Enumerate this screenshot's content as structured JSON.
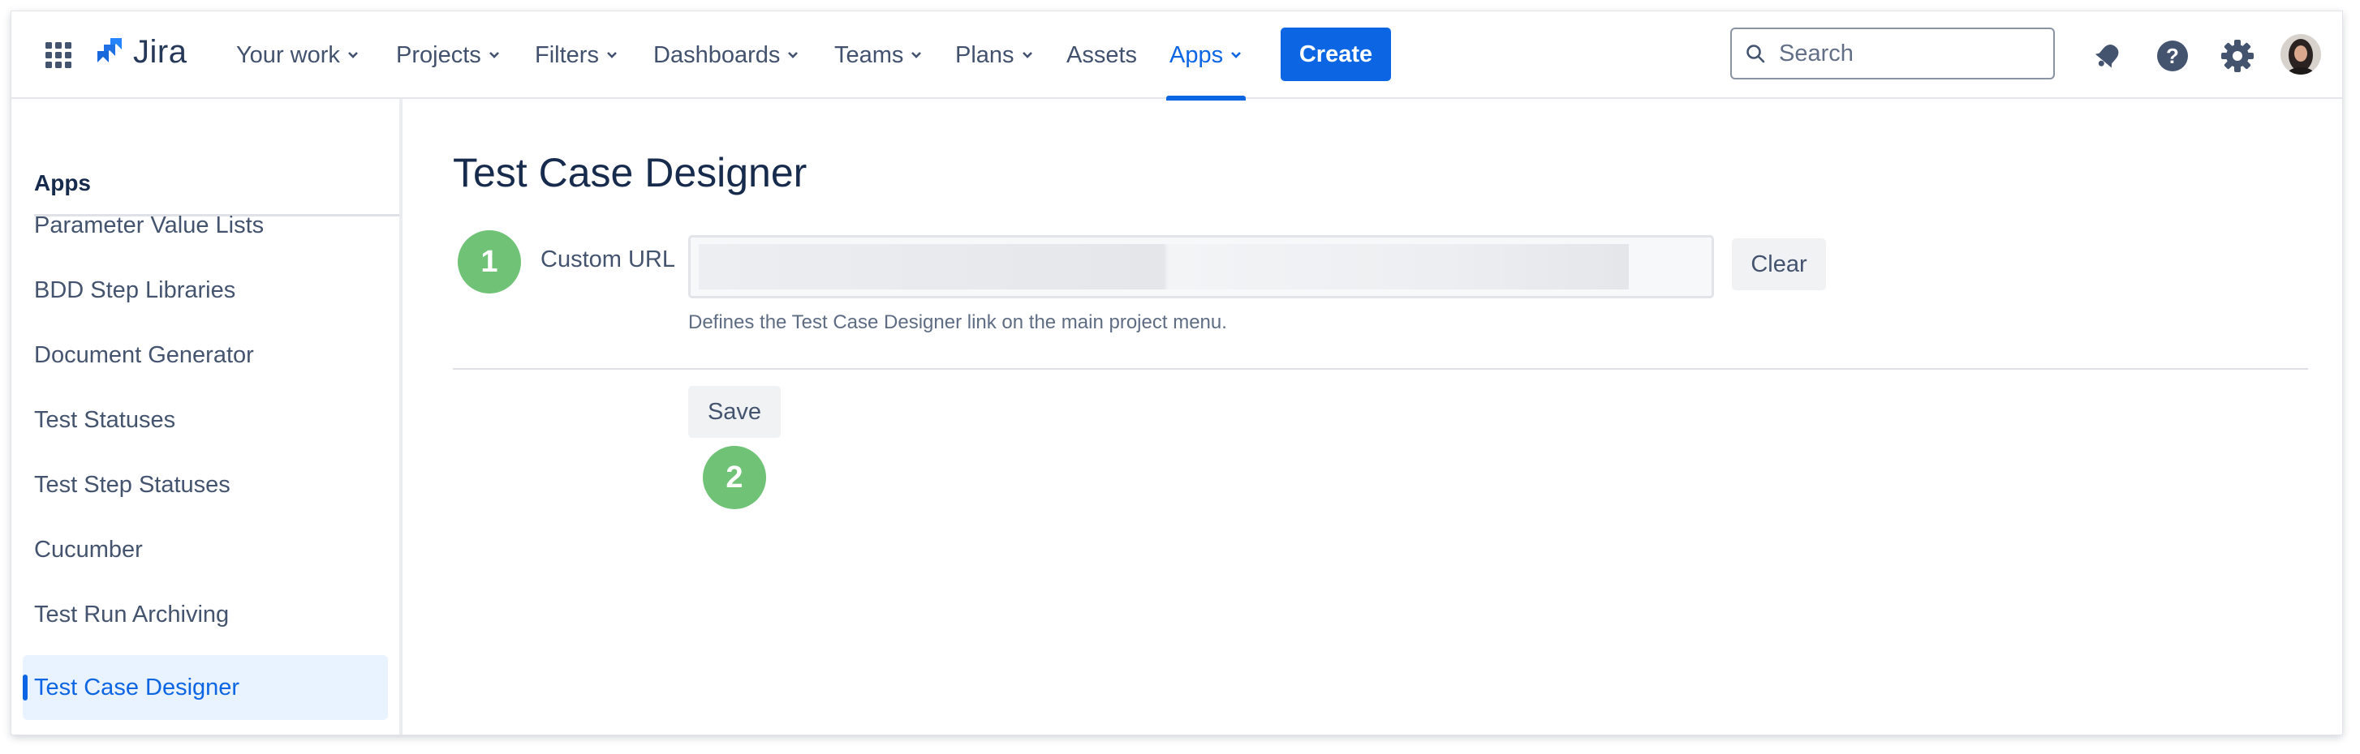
{
  "nav": {
    "logo_text": "Jira",
    "items": [
      {
        "label": "Your work",
        "dropdown": true
      },
      {
        "label": "Projects",
        "dropdown": true
      },
      {
        "label": "Filters",
        "dropdown": true
      },
      {
        "label": "Dashboards",
        "dropdown": true
      },
      {
        "label": "Teams",
        "dropdown": true
      },
      {
        "label": "Plans",
        "dropdown": true
      },
      {
        "label": "Assets",
        "dropdown": false
      },
      {
        "label": "Apps",
        "dropdown": true,
        "active": true
      }
    ],
    "create_label": "Create",
    "search_placeholder": "Search",
    "icons": [
      "app-switcher-icon",
      "jira-logo-icon",
      "notifications-icon",
      "help-icon",
      "settings-icon",
      "avatar"
    ]
  },
  "sidebar": {
    "heading": "Apps",
    "items": [
      {
        "label": "Parameter Value Lists"
      },
      {
        "label": "BDD Step Libraries"
      },
      {
        "label": "Document Generator"
      },
      {
        "label": "Test Statuses"
      },
      {
        "label": "Test Step Statuses"
      },
      {
        "label": "Cucumber"
      },
      {
        "label": "Test Run Archiving"
      },
      {
        "label": "Test Case Designer",
        "selected": true
      }
    ]
  },
  "main": {
    "title": "Test Case Designer",
    "custom_url_label": "Custom URL",
    "custom_url_value": "",
    "clear_label": "Clear",
    "helper_text": "Defines the Test Case Designer link on the main project menu.",
    "save_label": "Save",
    "step_badges": [
      "1",
      "2"
    ]
  },
  "colors": {
    "accent": "#0c66e4",
    "badge": "#6fc276",
    "selected_bg": "#e9f2ff",
    "text": "#172b4d"
  }
}
